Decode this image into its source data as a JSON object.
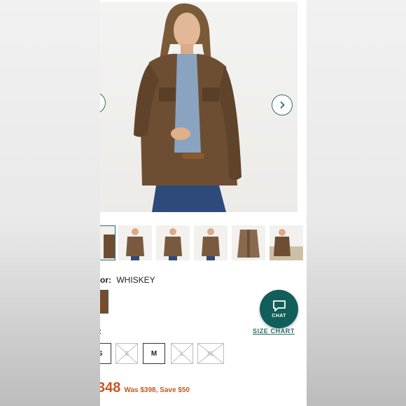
{
  "gallery": {
    "prev_icon": "chevron-left-icon",
    "next_icon": "chevron-right-icon",
    "thumbnail_count": 6,
    "selected_thumbnail": 1
  },
  "color": {
    "label": "or:",
    "value": "WHISKEY",
    "swatch_color": "#7a4b2b"
  },
  "size": {
    "label": ":",
    "chart_link": "SIZE CHART",
    "options": [
      {
        "label": "S",
        "available": true
      },
      {
        "label": "S",
        "available": false
      },
      {
        "label": "M",
        "available": true
      },
      {
        "label": "L",
        "available": false
      },
      {
        "label": "XL",
        "available": false
      }
    ]
  },
  "chat": {
    "label": "CHAT",
    "icon": "chat-bubble-icon"
  },
  "pricing": {
    "price": "348",
    "was_text": "Was $398, Save $50"
  },
  "colors": {
    "accent": "#2c6f6a",
    "chat_bg": "#125e5a",
    "price": "#c7581f"
  }
}
